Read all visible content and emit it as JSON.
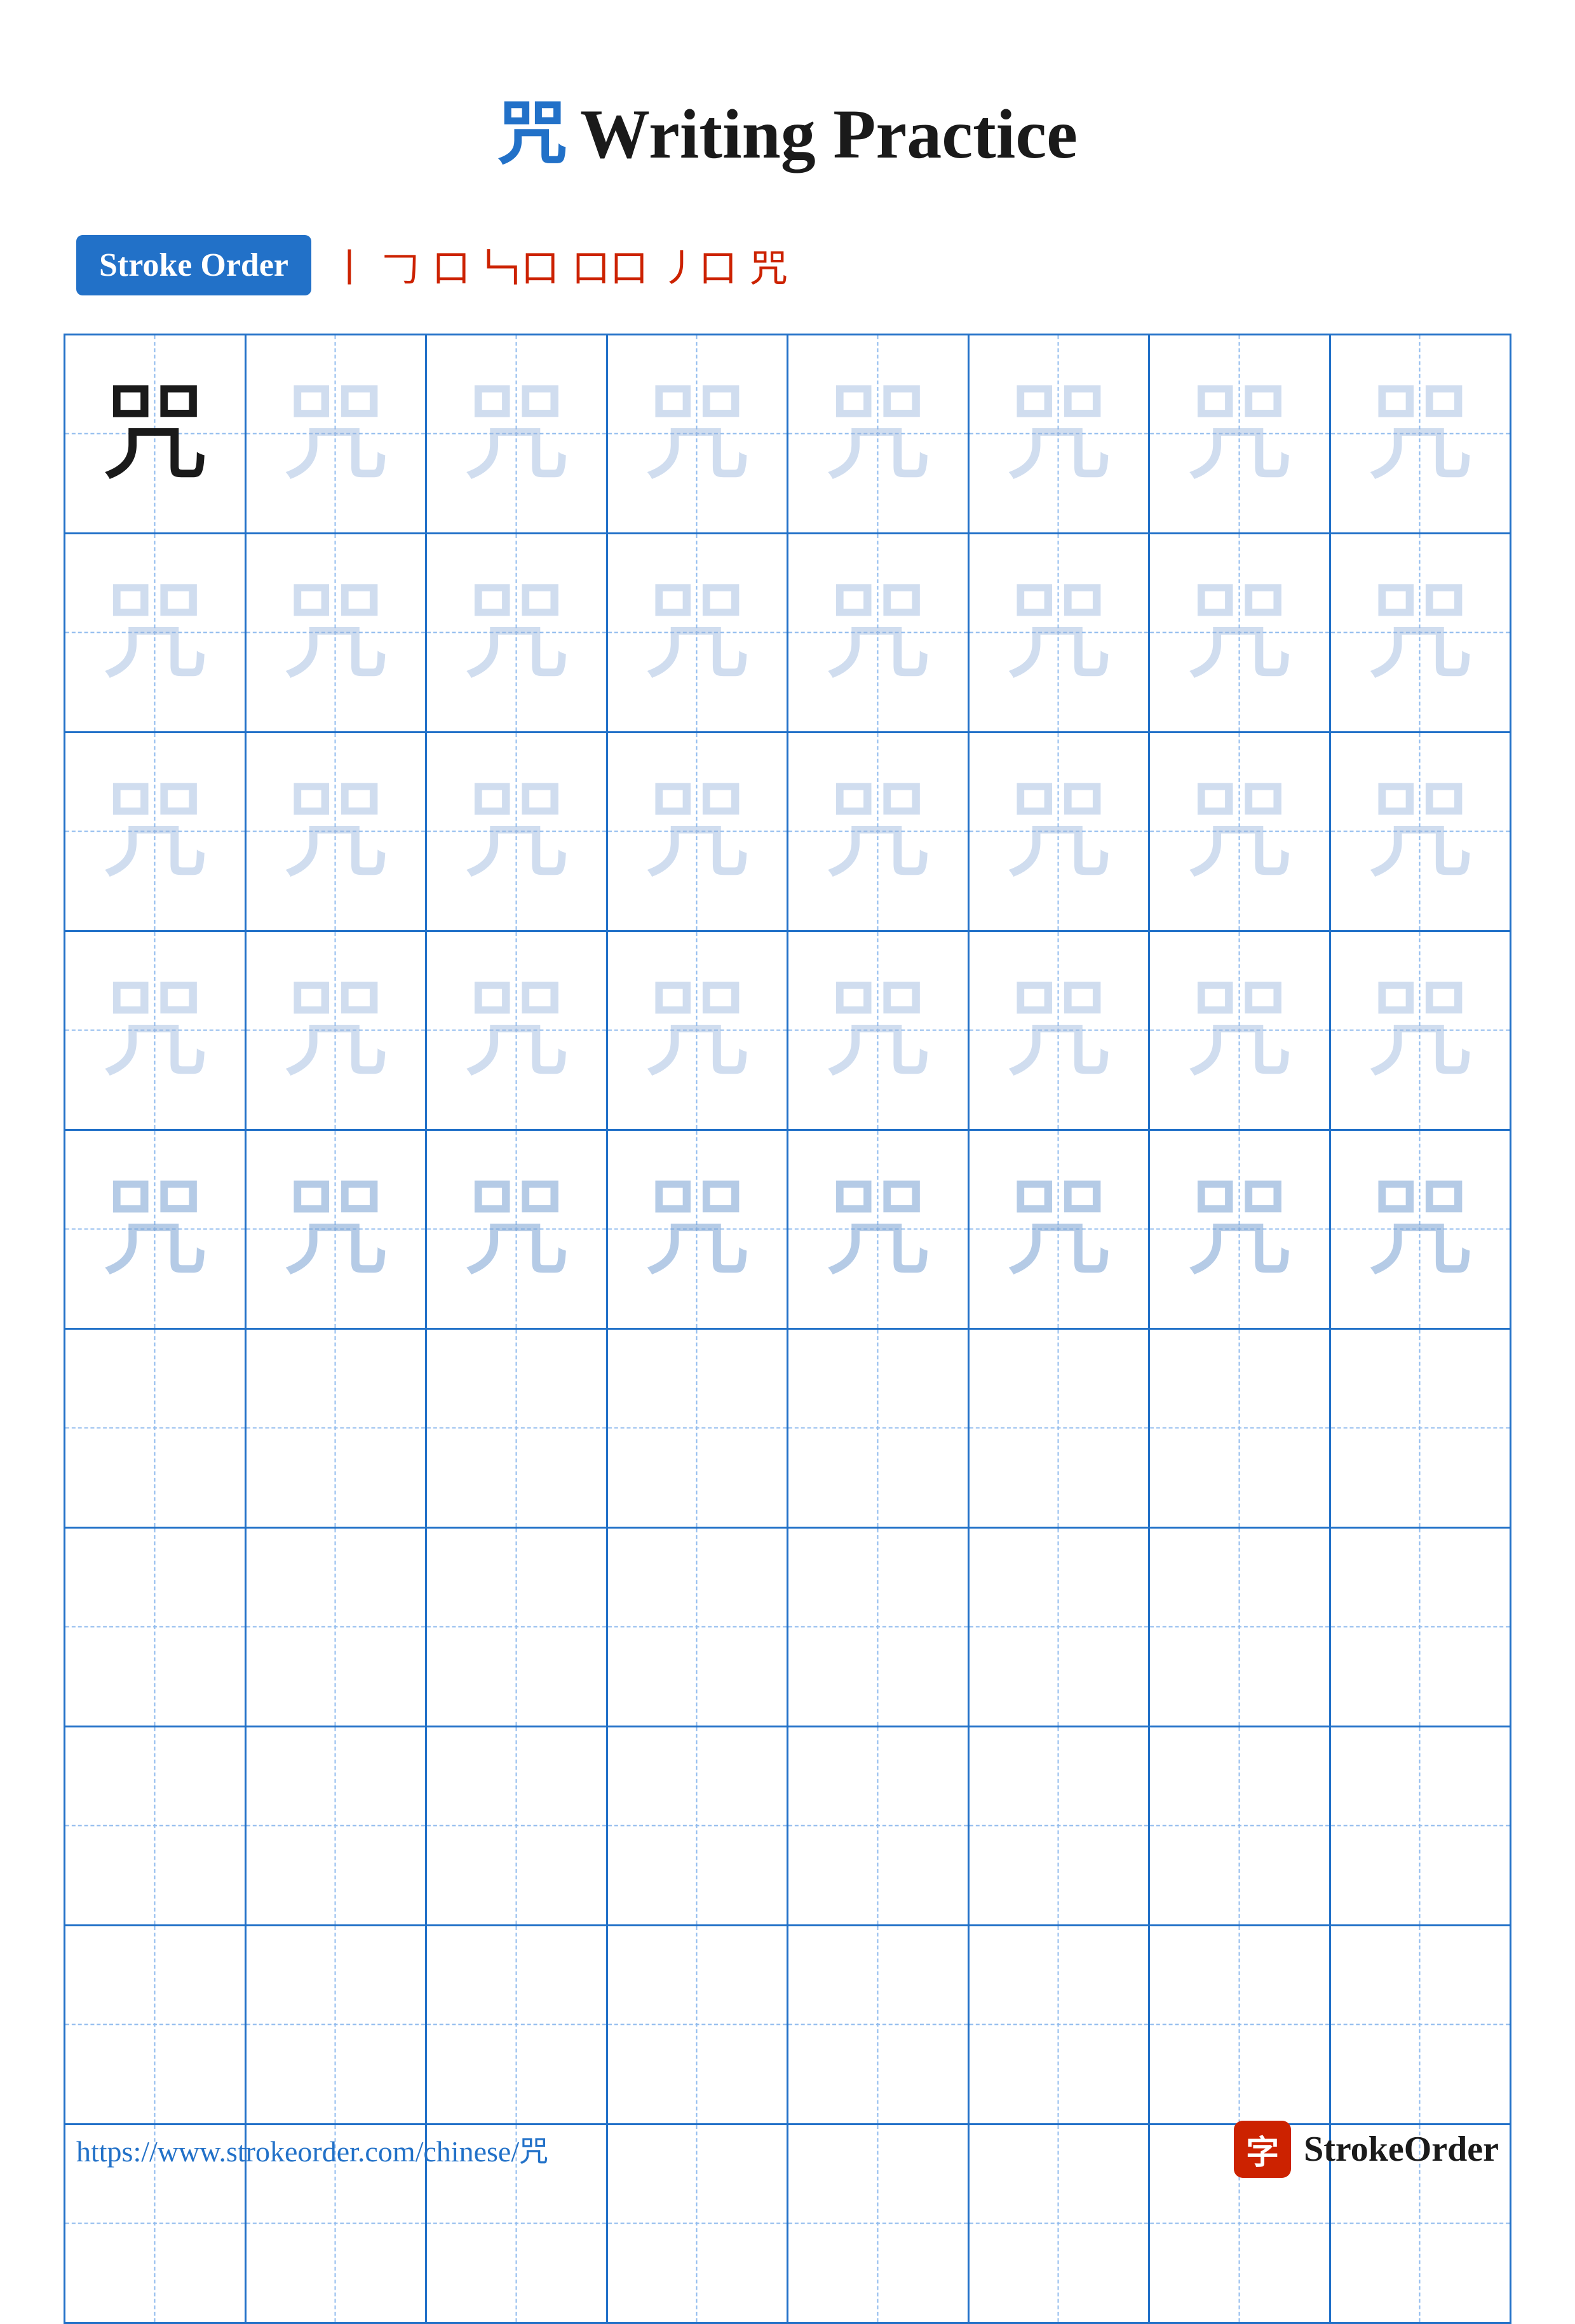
{
  "title": {
    "char": "咒",
    "text": "Writing Practice"
  },
  "stroke_order": {
    "badge_label": "Stroke Order",
    "strokes": [
      "丨",
      "𠃌",
      "口",
      "𠃑口",
      "口口",
      "丿口",
      "咒"
    ]
  },
  "grid": {
    "rows": 10,
    "cols": 8,
    "char": "咒",
    "guide_rows": 5,
    "empty_rows": 5
  },
  "footer": {
    "url": "https://www.strokeorder.com/chinese/咒",
    "logo_char": "字",
    "logo_name": "StrokeOrder"
  }
}
